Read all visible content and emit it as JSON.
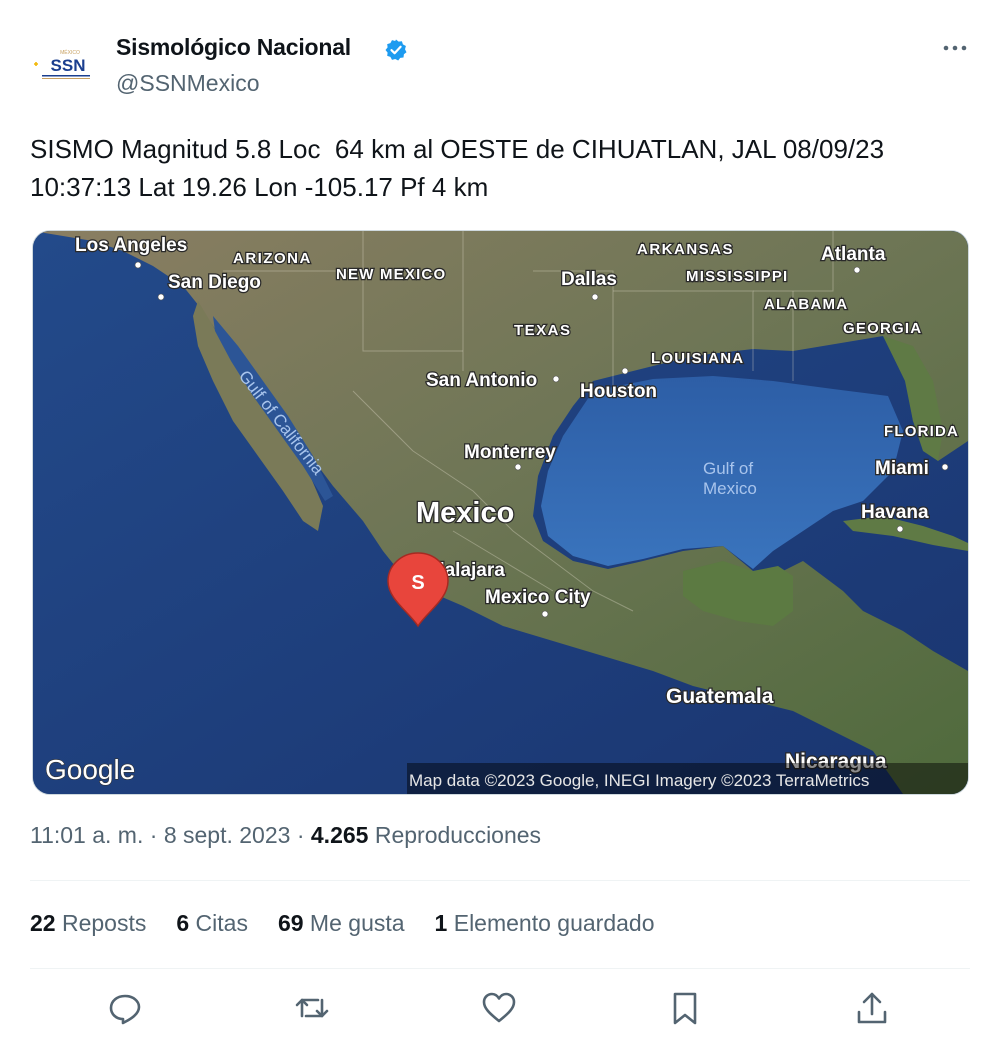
{
  "author": {
    "display_name": "Sismológico Nacional",
    "handle": "@SSNMexico",
    "avatar_text": "SSN",
    "avatar_subtext": "MÉXICO",
    "verified_icon": "verified-badge-icon",
    "verified_color": "#1d9bf0"
  },
  "tweet": {
    "line1": "SISMO Magnitud 5.8 Loc  64 km al OESTE de CIHUATLAN, JAL 08/09/23",
    "line2": "10:37:13 Lat 19.26 Lon -105.17 Pf 4 km"
  },
  "map": {
    "labels": {
      "los_angeles": "Los Angeles",
      "san_diego": "San Diego",
      "arizona": "ARIZONA",
      "new_mexico": "NEW MEXICO",
      "arkansas": "ARKANSAS",
      "atlanta": "Atlanta",
      "dallas": "Dallas",
      "mississippi": "MISSISSIPPI",
      "alabama": "ALABAMA",
      "texas": "TEXAS",
      "georgia": "GEORGIA",
      "louisiana": "LOUISIANA",
      "san_antonio": "San Antonio",
      "houston": "Houston",
      "gulf_of_california": "Gulf of California",
      "florida": "FLORIDA",
      "monterrey": "Monterrey",
      "gulf_of_mexico_1": "Gulf of",
      "gulf_of_mexico_2": "Mexico",
      "miami": "Miami",
      "mexico": "Mexico",
      "havana": "Havana",
      "guadalajara": "dalajara",
      "mexico_city": "Mexico City",
      "guatemala": "Guatemala",
      "nicaragua": "Nicaragua",
      "google": "Google",
      "attribution": "Map data ©2023 Google, INEGI Imagery ©2023 TerraMetrics"
    },
    "marker_label": "S",
    "marker_color": "#e8453c"
  },
  "meta": {
    "time": "11:01 a. m.",
    "sep1": " · ",
    "date": "8 sept. 2023",
    "sep2": " · ",
    "views_count": "4.265",
    "views_label": " Reproducciones"
  },
  "stats": [
    {
      "count": "22",
      "label": " Reposts"
    },
    {
      "count": "6",
      "label": " Citas"
    },
    {
      "count": "69",
      "label": " Me gusta"
    },
    {
      "count": "1",
      "label": " Elemento guardado"
    }
  ],
  "actions": [
    "reply-icon",
    "repost-icon",
    "like-icon",
    "bookmark-icon",
    "share-icon"
  ]
}
